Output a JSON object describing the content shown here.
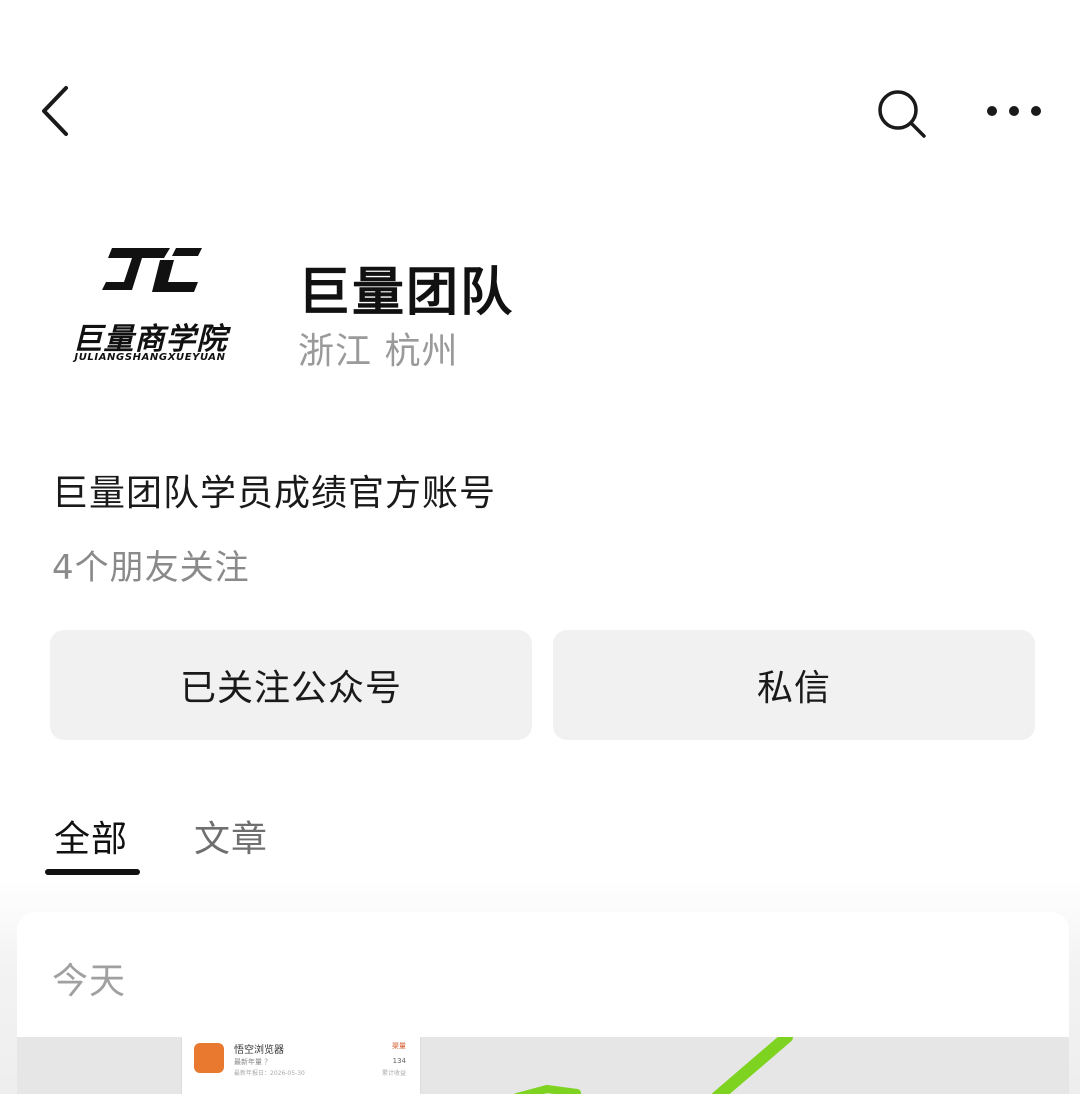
{
  "account": {
    "name": "巨量团队",
    "location": "浙江 杭州",
    "intro": "巨量团队学员成绩官方账号",
    "friends_following": "4个朋友关注"
  },
  "avatar": {
    "logo_text_cn": "巨量商学院",
    "logo_text_en": "JULIANGSHANGXUEYUAN"
  },
  "actions": {
    "follow_label": "已关注公众号",
    "message_label": "私信"
  },
  "tabs": [
    {
      "label": "全部",
      "active": true
    },
    {
      "label": "文章",
      "active": false
    }
  ],
  "feed": {
    "date_label": "今天",
    "preview": {
      "app_name": "悟空浏览器",
      "subtitle": "最新年量 ？",
      "meta": "最新年报日：2026-05-30",
      "badge": "渠量",
      "count": "134",
      "count_label": "累计收益"
    }
  },
  "colors": {
    "text_primary": "#111111",
    "text_secondary": "#9a9a9a",
    "button_bg": "#f1f1f1",
    "accent_green": "#7ed321"
  }
}
